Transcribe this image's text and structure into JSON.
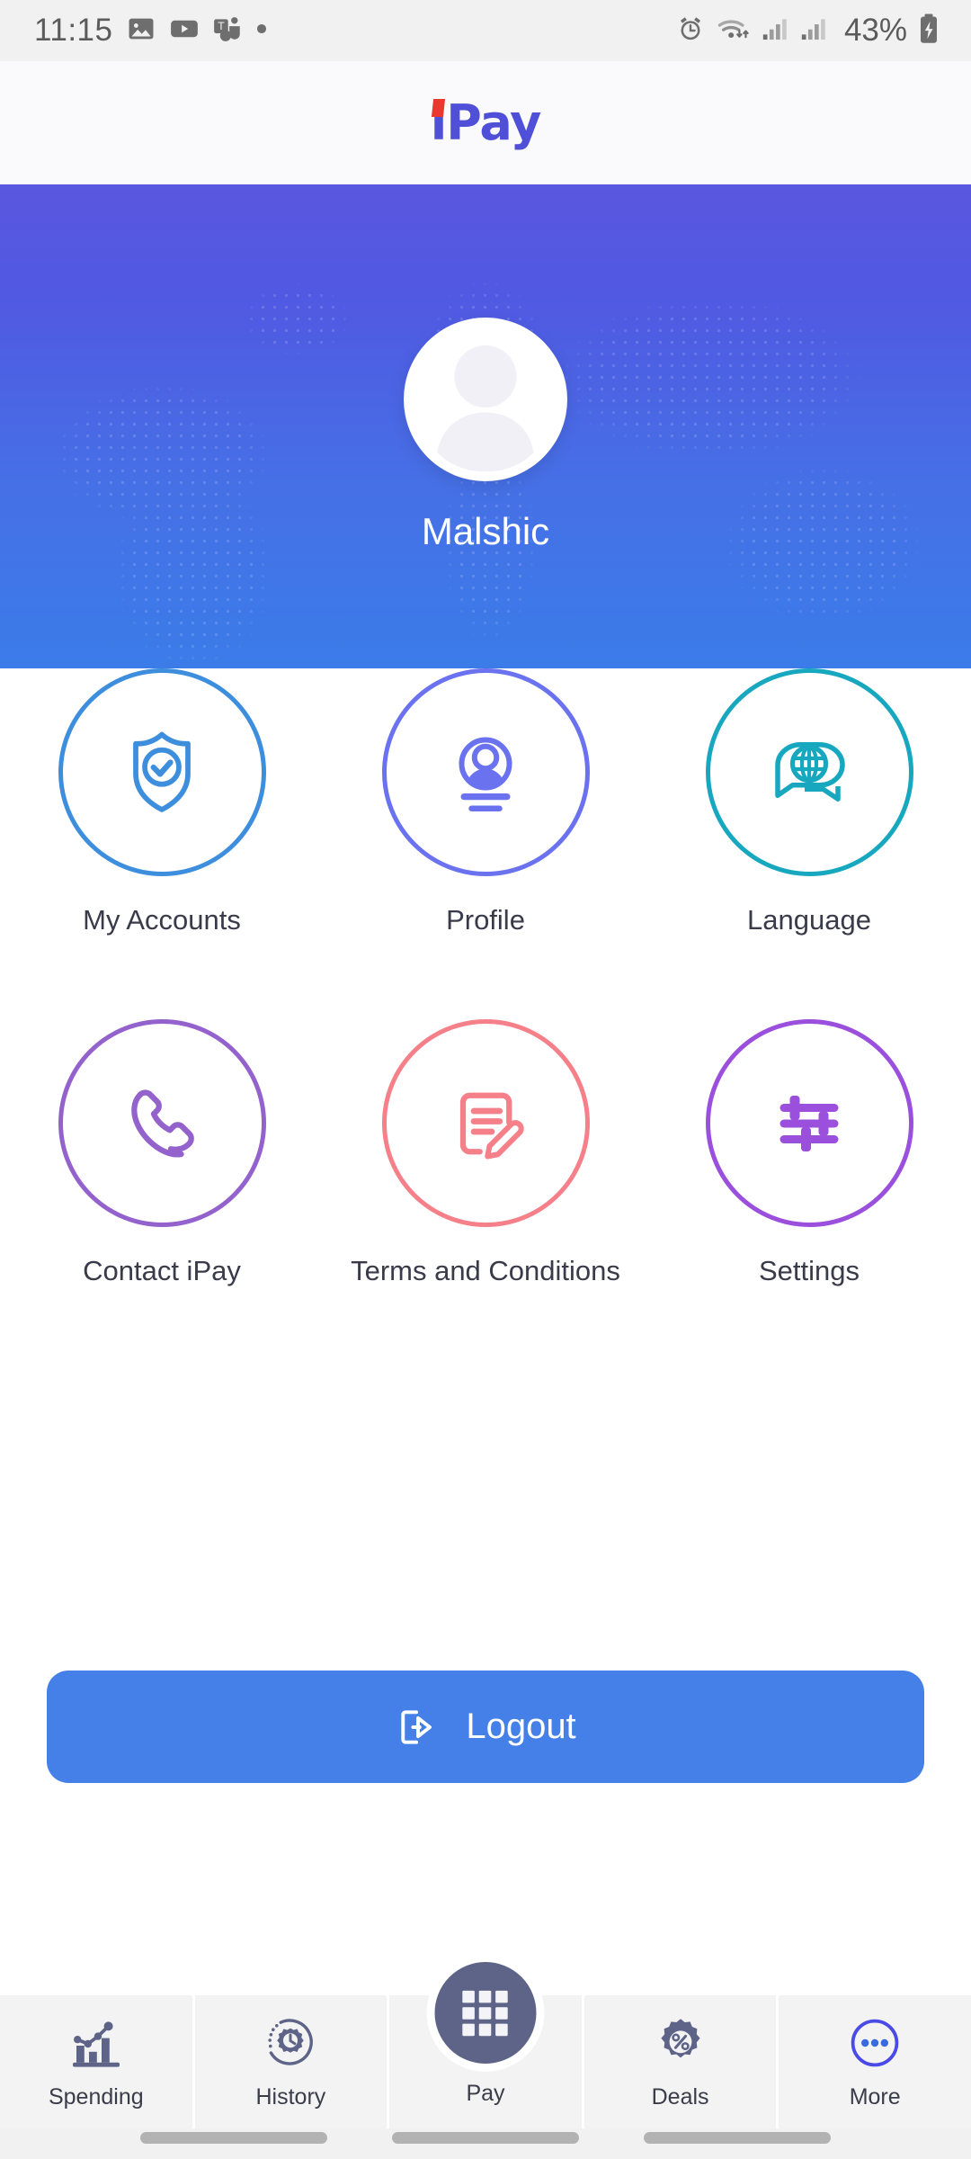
{
  "status_bar": {
    "time": "11:15",
    "battery_percent": "43%",
    "left_icons": [
      "photos-icon",
      "youtube-icon",
      "teams-icon",
      "dot-indicator-icon"
    ],
    "right_icons": [
      "alarm-icon",
      "wifi-icon",
      "signal-sim1-icon",
      "signal-sim2-icon",
      "battery-charging-icon"
    ],
    "bg_color": "#f1f1f1",
    "text_color": "#5b5b5b"
  },
  "app_bar": {
    "logo_text": "iPay",
    "logo_color": "#4f4fd8",
    "logo_accent_color": "#e8392e",
    "bg_color": "#fafafc"
  },
  "profile_header": {
    "username": "Malshic",
    "avatar_icon": "user-avatar-placeholder-icon",
    "gradient_top": "#5a57e0",
    "gradient_bottom": "#3b7ce9",
    "background_pattern": "dotted-world-map"
  },
  "menu_grid": {
    "rows": [
      [
        {
          "label": "My Accounts",
          "icon": "shield-check-icon",
          "color": "#3e8ede"
        },
        {
          "label": "Profile",
          "icon": "user-circle-icon",
          "color": "#6a72ef"
        },
        {
          "label": "Language",
          "icon": "globe-chat-icon",
          "color": "#17a8c0"
        }
      ],
      [
        {
          "label": "Contact iPay",
          "icon": "phone-handset-icon",
          "color": "#9462cd"
        },
        {
          "label": "Terms and Conditions",
          "icon": "document-pencil-icon",
          "color": "#f58089"
        },
        {
          "label": "Settings",
          "icon": "sliders-icon",
          "color": "#9b4fdd"
        }
      ]
    ],
    "label_color": "#393b4a"
  },
  "logout_button": {
    "label": "Logout",
    "icon": "logout-arrow-icon",
    "bg_color": "#4580e8",
    "text_color": "#ffffff"
  },
  "bottom_nav": {
    "items": [
      {
        "label": "Spending",
        "icon": "bar-chart-icon"
      },
      {
        "label": "History",
        "icon": "clock-gear-icon"
      },
      {
        "label": "Pay",
        "icon": "grid-keypad-icon",
        "primary": true
      },
      {
        "label": "Deals",
        "icon": "percent-badge-icon"
      },
      {
        "label": "More",
        "icon": "ellipsis-circle-icon"
      }
    ],
    "bg_color": "#f1f1f1",
    "icon_color": "#5e6487",
    "more_icon_color": "#4a4ae8",
    "fab_color": "#5e6487"
  },
  "system_gesture": {
    "bars": 3,
    "color": "#b2b2b2"
  }
}
